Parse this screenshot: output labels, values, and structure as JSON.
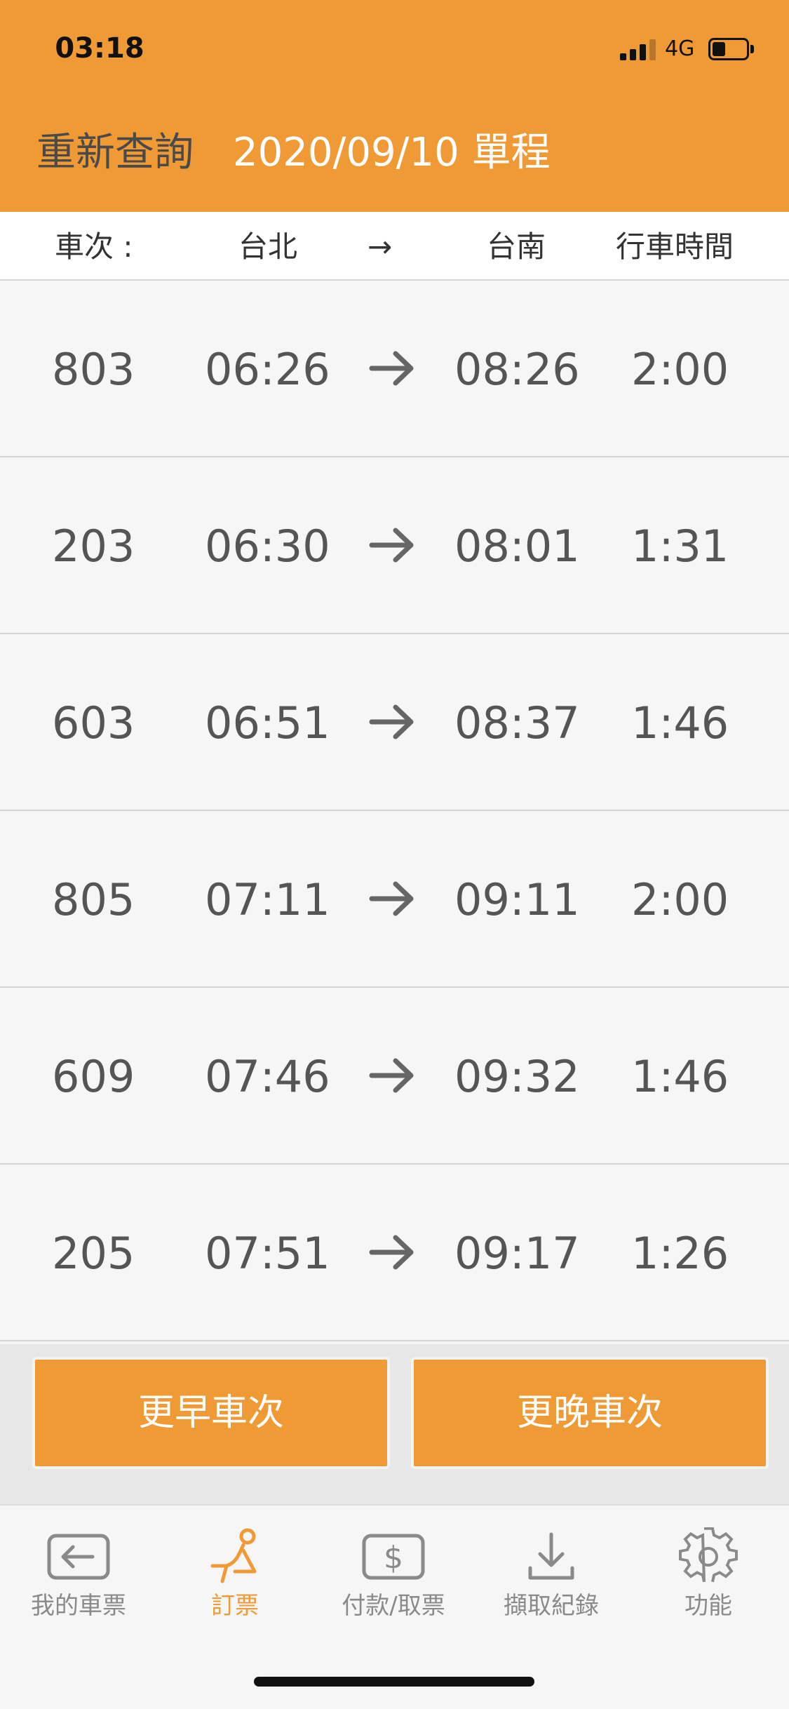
{
  "status_bar": {
    "time": "03:18",
    "network": "4G"
  },
  "header": {
    "requery_label": "重新查詢",
    "date_trip": "2020/09/10 單程"
  },
  "columns": {
    "train": "車次 :",
    "origin": "台北",
    "arrow": "→",
    "destination": "台南",
    "duration": "行車時間"
  },
  "trains": [
    {
      "no": "803",
      "dep": "06:26",
      "arr": "08:26",
      "dur": "2:00"
    },
    {
      "no": "203",
      "dep": "06:30",
      "arr": "08:01",
      "dur": "1:31"
    },
    {
      "no": "603",
      "dep": "06:51",
      "arr": "08:37",
      "dur": "1:46"
    },
    {
      "no": "805",
      "dep": "07:11",
      "arr": "09:11",
      "dur": "2:00"
    },
    {
      "no": "609",
      "dep": "07:46",
      "arr": "09:32",
      "dur": "1:46"
    },
    {
      "no": "205",
      "dep": "07:51",
      "arr": "09:17",
      "dur": "1:26"
    }
  ],
  "buttons": {
    "earlier": "更早車次",
    "later": "更晚車次"
  },
  "tabs": [
    {
      "label": "我的車票",
      "icon": "my-tickets-icon"
    },
    {
      "label": "訂票",
      "icon": "seat-icon",
      "active": true
    },
    {
      "label": "付款/取票",
      "icon": "payment-icon"
    },
    {
      "label": "擷取紀錄",
      "icon": "download-icon"
    },
    {
      "label": "功能",
      "icon": "gear-icon"
    }
  ],
  "colors": {
    "accent": "#ef9a35",
    "text": "#555555",
    "tab_inactive": "#8a8a8a"
  }
}
